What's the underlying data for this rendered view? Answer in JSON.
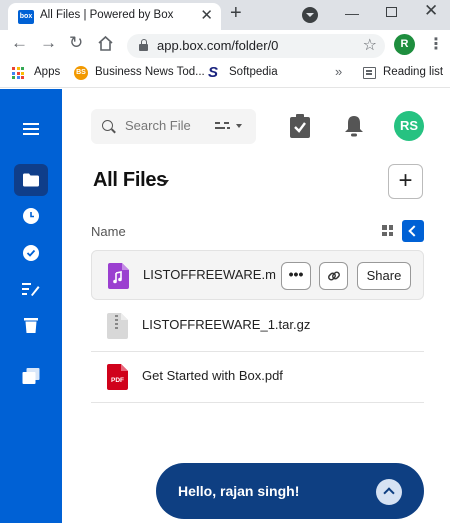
{
  "browser": {
    "tab_title": "All Files | Powered by Box",
    "favicon_text": "box",
    "tab_close": "✕",
    "new_tab": "+",
    "minimize": "—",
    "window_close": "✕",
    "url": "app.box.com/folder/0",
    "profile_initial": "R",
    "bookmarks": {
      "apps_label": "Apps",
      "business_news_label": "Business News Tod...",
      "softpedia_label": "Softpedia",
      "more_label": "»",
      "reading_list_label": "Reading list"
    }
  },
  "header": {
    "search_placeholder": "Search Files",
    "user_initials": "RS"
  },
  "main": {
    "title": "All Files",
    "new_label": "+",
    "column_name": "Name",
    "files": [
      {
        "name": "LISTOFFREEWARE.m",
        "icon": "audio-file-icon",
        "selected": true
      },
      {
        "name": "LISTOFFREEWARE_1.tar.gz",
        "icon": "zip-file-icon",
        "selected": false
      },
      {
        "name": "Get Started with Box.pdf",
        "icon": "pdf-file-icon",
        "selected": false
      }
    ],
    "row_actions": {
      "more_label": "•••",
      "share_label": "Share"
    },
    "pdf_badge": "PDF"
  },
  "greeting": {
    "text": "Hello, rajan singh!"
  },
  "colors": {
    "box_blue": "#0061d5",
    "nav_active": "#0f3e8a",
    "avatar_green": "#26c281",
    "greeting_bg": "#0e3f82"
  }
}
